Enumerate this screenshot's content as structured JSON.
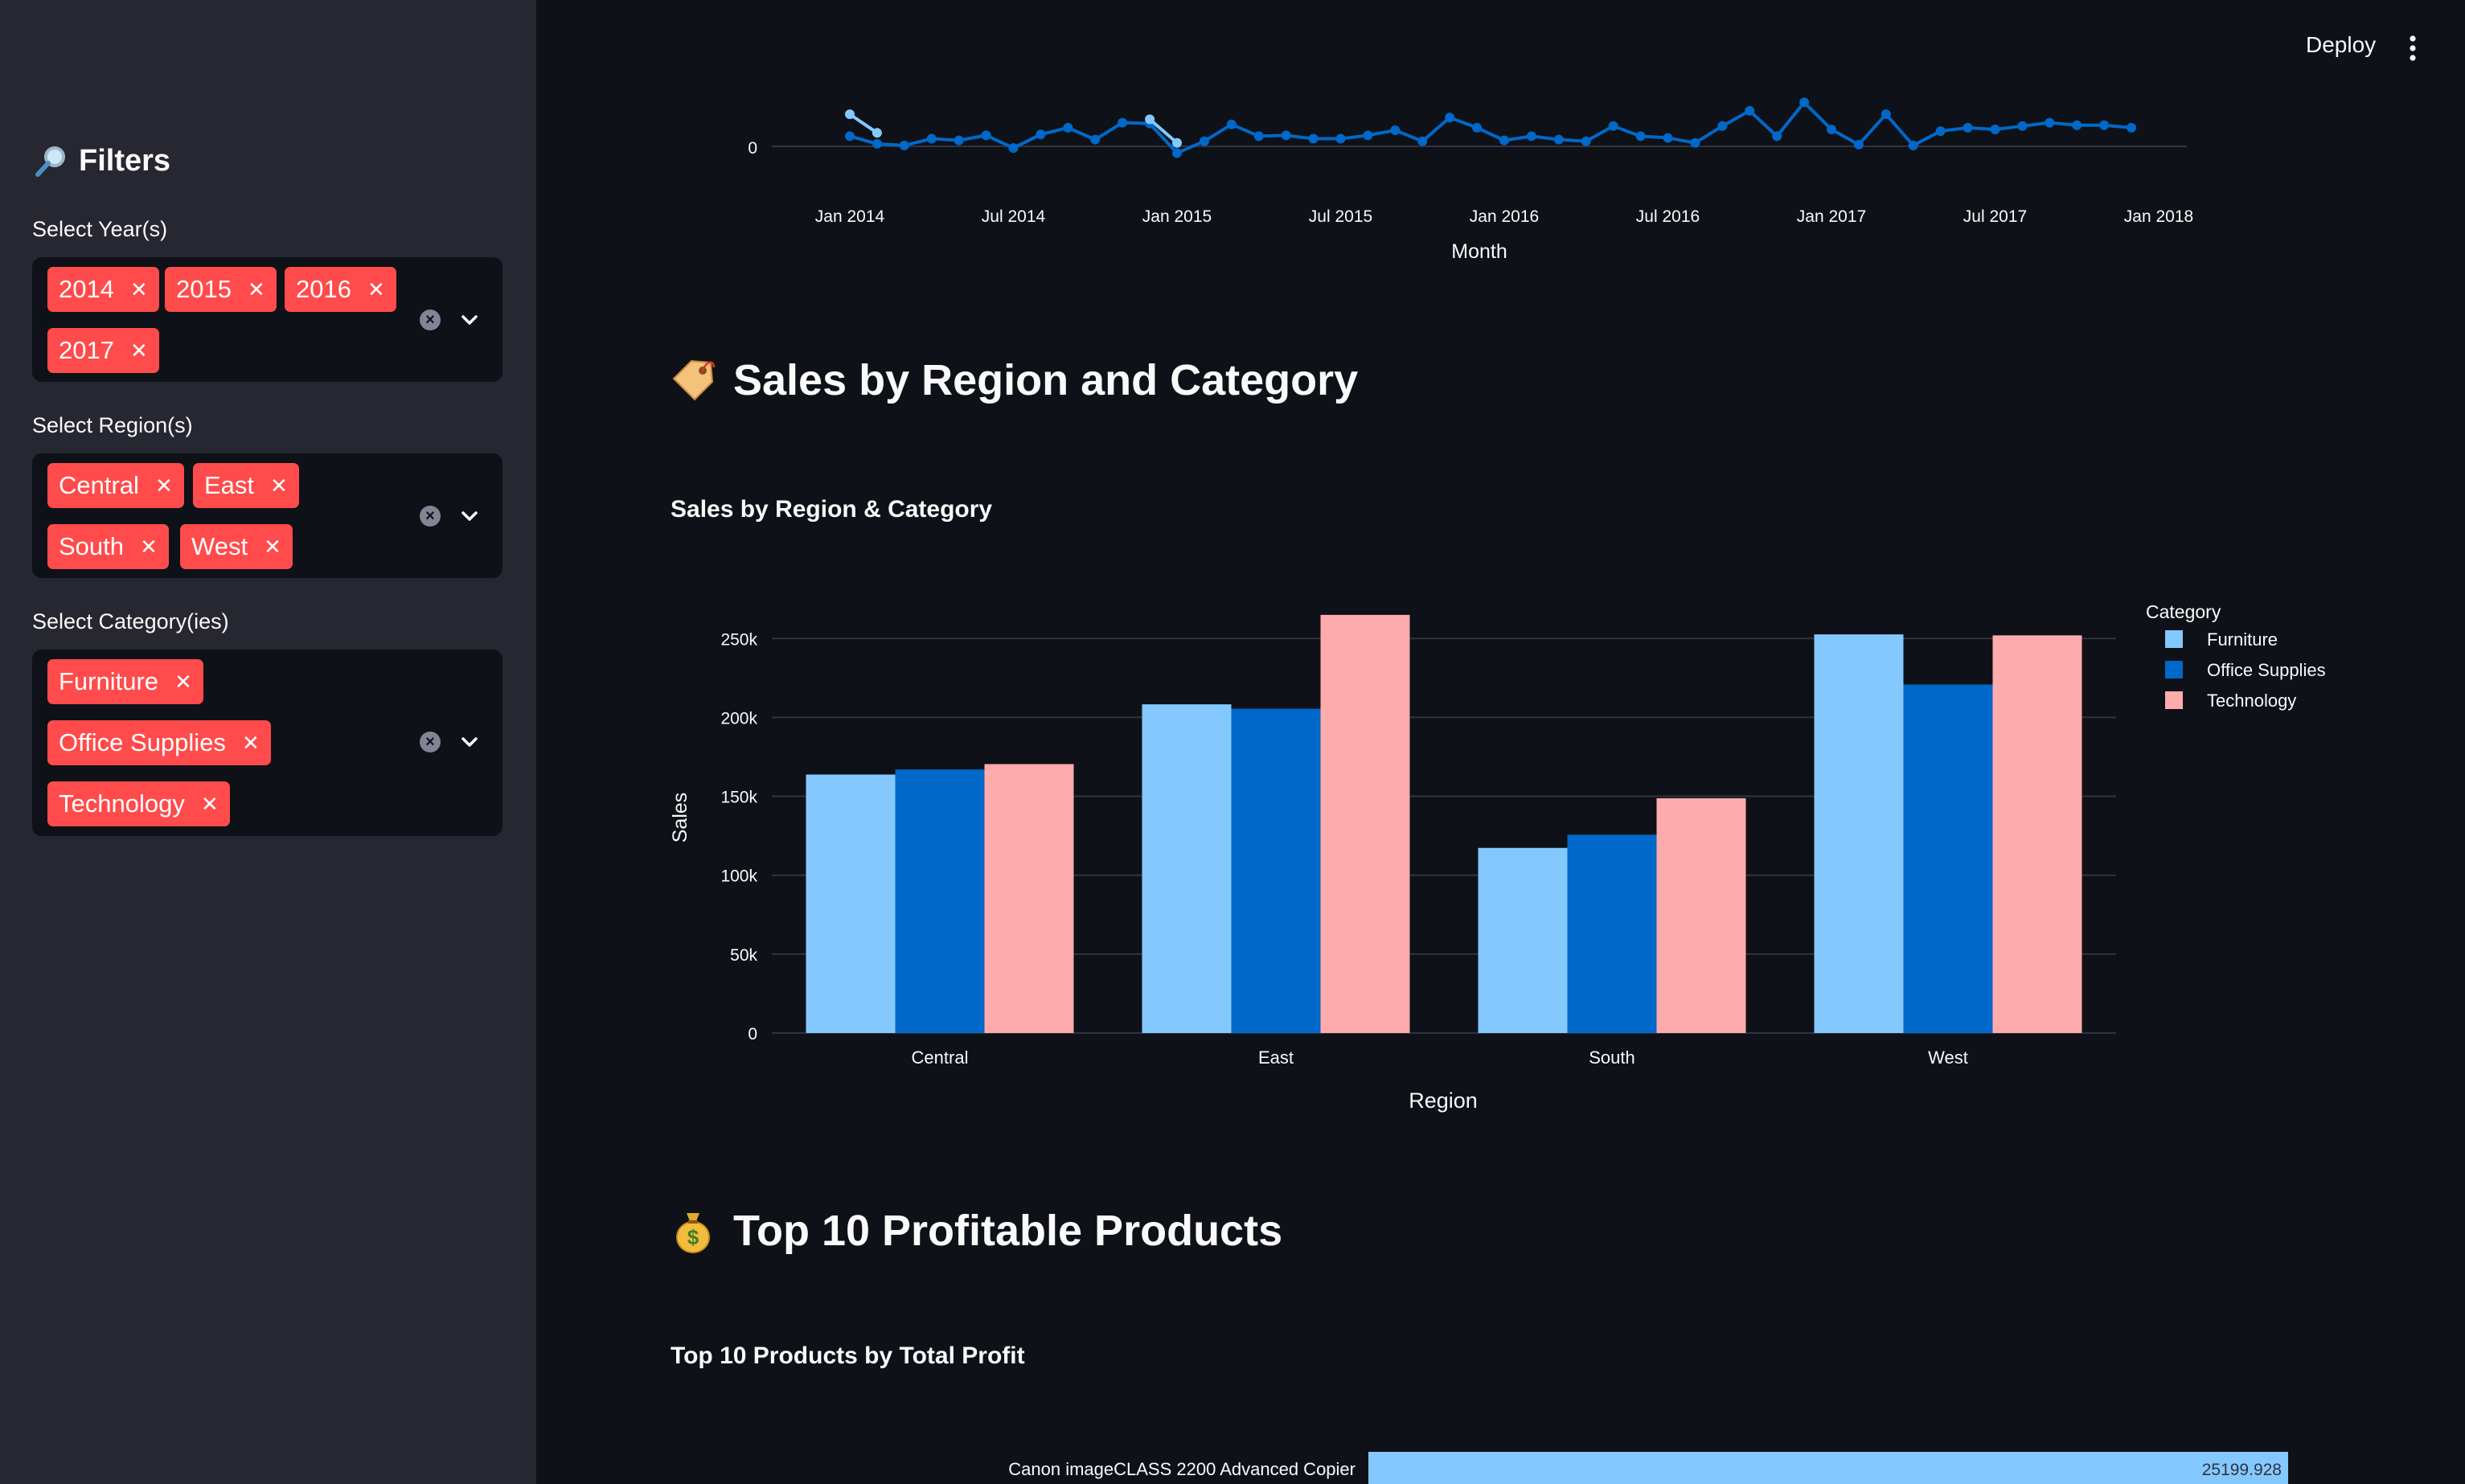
{
  "sidebar": {
    "title": "Filters",
    "filters": [
      {
        "label": "Select Year(s)",
        "selected": [
          "2014",
          "2015",
          "2016",
          "2017"
        ]
      },
      {
        "label": "Select Region(s)",
        "selected": [
          "Central",
          "East",
          "South",
          "West"
        ]
      },
      {
        "label": "Select Category(ies)",
        "selected": [
          "Furniture",
          "Office Supplies",
          "Technology"
        ]
      }
    ]
  },
  "header": {
    "deploy_label": "Deploy"
  },
  "sections": {
    "region_category_title": "Sales by Region and Category",
    "top_products_title": "Top 10 Profitable Products"
  },
  "colors": {
    "accent": "#ff4b4b",
    "background": "#0e1117",
    "sidebar": "#262730",
    "furniture": "#83c9ff",
    "office_supplies": "#0068c9",
    "technology": "#ffabab"
  },
  "chart_data": [
    {
      "type": "line",
      "title": "",
      "xlabel": "Month",
      "ylabel": "",
      "x_ticks": [
        "Jan 2014",
        "Jul 2014",
        "Jan 2015",
        "Jul 2015",
        "Jan 2016",
        "Jul 2016",
        "Jan 2017",
        "Jul 2017",
        "Jan 2018"
      ],
      "y_ticks_visible": [
        "0"
      ],
      "series": [
        {
          "values": [
            6,
            1.5,
            0.5,
            4.5,
            3.5,
            6.5,
            -1,
            7,
            11,
            4,
            14,
            13.5,
            -4,
            3,
            13,
            6,
            6.5,
            4.5,
            4.5,
            6.5,
            9.5,
            3,
            17,
            11,
            3.5,
            6,
            4,
            3,
            12,
            6,
            5,
            2,
            12,
            21,
            6,
            26,
            10,
            1,
            19,
            0.5,
            9,
            11,
            10,
            12,
            14,
            12.5,
            12.5,
            11
          ]
        },
        {
          "values": [
            19,
            8,
            null,
            null,
            null,
            null,
            null,
            null,
            null,
            null,
            null,
            16,
            2,
            null,
            null,
            null,
            null,
            null,
            null,
            null,
            null,
            null,
            null,
            null,
            null,
            null,
            null,
            null,
            null,
            null,
            null,
            null,
            null,
            null,
            null,
            null,
            null,
            null,
            null,
            null,
            null,
            null,
            null,
            null,
            null,
            null,
            null,
            null
          ]
        }
      ]
    },
    {
      "type": "bar",
      "title": "Sales by Region & Category",
      "xlabel": "Region",
      "ylabel": "Sales",
      "categories": [
        "Central",
        "East",
        "South",
        "West"
      ],
      "legend_title": "Category",
      "legend_position": "top-right",
      "ylim": [
        0,
        270000
      ],
      "y_ticks": [
        0,
        50000,
        100000,
        150000,
        200000,
        250000
      ],
      "y_tick_labels": [
        "0",
        "50k",
        "100k",
        "150k",
        "200k",
        "250k"
      ],
      "series": [
        {
          "name": "Furniture",
          "values": [
            163797,
            208291,
            117299,
            252613
          ]
        },
        {
          "name": "Office Supplies",
          "values": [
            167026,
            205516,
            125651,
            220853
          ]
        },
        {
          "name": "Technology",
          "values": [
            170416,
            264974,
            148772,
            251992
          ]
        }
      ]
    },
    {
      "type": "bar",
      "orientation": "horizontal",
      "title": "Top 10 Products by Total Profit",
      "categories": [
        "Canon imageCLASS 2200 Advanced Copier"
      ],
      "values": [
        25199.928
      ],
      "value_labels": [
        "25199.928"
      ]
    }
  ]
}
